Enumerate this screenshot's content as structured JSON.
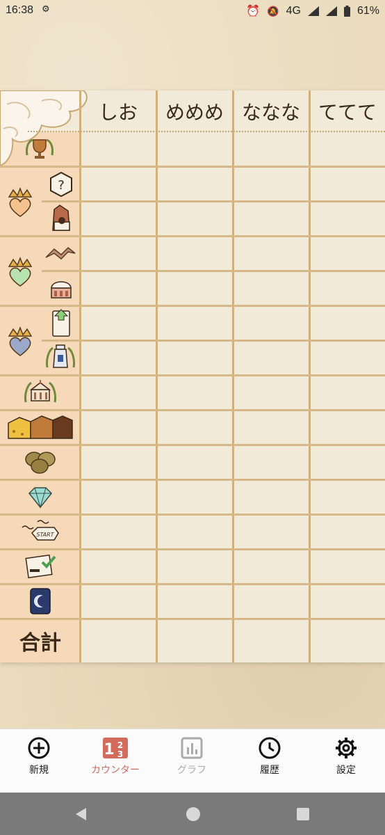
{
  "status_bar": {
    "time": "16:38",
    "network": "4G",
    "battery": "61%",
    "icons": [
      "settings-icon",
      "alarm-icon",
      "mute-icon",
      "signal-icon",
      "battery-icon"
    ]
  },
  "table": {
    "players": [
      "しお",
      "めめめ",
      "ななな",
      "ててて"
    ],
    "rows": [
      {
        "group": "trophy",
        "icons": [
          "trophy-icon"
        ]
      },
      {
        "group": "orange-heart-crown",
        "icons": [
          "question-tile-icon"
        ]
      },
      {
        "group": "orange-heart-crown",
        "icons": [
          "tower-card-icon"
        ]
      },
      {
        "group": "green-heart-crown",
        "icons": [
          "ribbon-icon"
        ]
      },
      {
        "group": "green-heart-crown",
        "icons": [
          "cake-icon"
        ]
      },
      {
        "group": "blue-heart-crown",
        "icons": [
          "upload-card-icon"
        ]
      },
      {
        "group": "blue-heart-crown",
        "icons": [
          "milk-can-icon"
        ]
      },
      {
        "group": "building",
        "icons": [
          "building-laurel-icon"
        ]
      },
      {
        "group": "blocks",
        "icons": [
          "cheese-blocks-icon"
        ]
      },
      {
        "group": "coins",
        "icons": [
          "coins-icon"
        ]
      },
      {
        "group": "gem",
        "icons": [
          "diamond-icon"
        ]
      },
      {
        "group": "start",
        "icons": [
          "start-tile-icon"
        ]
      },
      {
        "group": "card",
        "icons": [
          "checked-card-icon"
        ]
      },
      {
        "group": "moon",
        "icons": [
          "moon-card-icon"
        ]
      }
    ],
    "total_label": "合計",
    "colors": {
      "line": "#d2b07c",
      "cell": "#f2ead9",
      "label_bg": "#f5d9b8"
    }
  },
  "bottom_nav": {
    "items": [
      {
        "label": "新規",
        "icon": "add-circle-icon",
        "active": false
      },
      {
        "label": "カウンター",
        "icon": "counter-icon",
        "active": true
      },
      {
        "label": "グラフ",
        "icon": "graph-icon",
        "active": false
      },
      {
        "label": "履歴",
        "icon": "clock-icon",
        "active": false
      },
      {
        "label": "設定",
        "icon": "gear-icon",
        "active": false
      }
    ],
    "colors": {
      "active": "#d46a5c",
      "inactive": "#222222",
      "disabled": "#aaaaaa"
    }
  },
  "system_nav": {
    "icons": [
      "back-icon",
      "home-icon",
      "recents-icon"
    ]
  }
}
